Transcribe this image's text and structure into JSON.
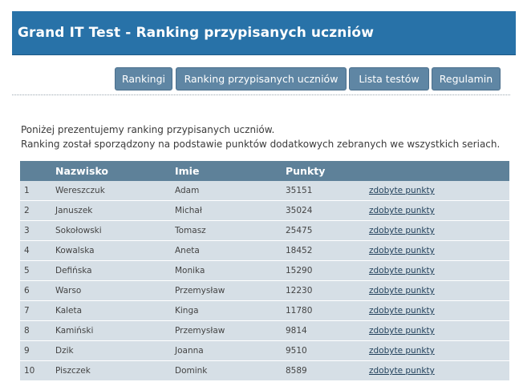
{
  "header": {
    "title": "Grand IT Test - Ranking przypisanych uczniów"
  },
  "nav": {
    "items": [
      {
        "label": "Rankingi"
      },
      {
        "label": "Ranking przypisanych uczniów"
      },
      {
        "label": "Lista testów"
      },
      {
        "label": "Regulamin"
      }
    ]
  },
  "intro": {
    "line1": "Poniżej prezentujemy ranking przypisanych uczniów.",
    "line2": "Ranking został sporządzony na podstawie punktów dodatkowych zebranych we wszystkich seriach."
  },
  "table": {
    "headers": {
      "num": "",
      "nazwisko": "Nazwisko",
      "imie": "Imie",
      "punkty": "Punkty",
      "link": ""
    },
    "rows": [
      {
        "num": "1",
        "nazwisko": "Wereszczuk",
        "imie": "Adam",
        "punkty": "35151",
        "link": "zdobyte punkty"
      },
      {
        "num": "2",
        "nazwisko": "Januszek",
        "imie": "Michał",
        "punkty": "35024",
        "link": "zdobyte punkty"
      },
      {
        "num": "3",
        "nazwisko": "Sokołowski",
        "imie": "Tomasz",
        "punkty": "25475",
        "link": "zdobyte punkty"
      },
      {
        "num": "4",
        "nazwisko": "Kowalska",
        "imie": "Aneta",
        "punkty": "18452",
        "link": "zdobyte punkty"
      },
      {
        "num": "5",
        "nazwisko": "Defińska",
        "imie": "Monika",
        "punkty": "15290",
        "link": "zdobyte punkty"
      },
      {
        "num": "6",
        "nazwisko": "Warso",
        "imie": "Przemysław",
        "punkty": "12230",
        "link": "zdobyte punkty"
      },
      {
        "num": "7",
        "nazwisko": "Kaleta",
        "imie": "Kinga",
        "punkty": "11780",
        "link": "zdobyte punkty"
      },
      {
        "num": "8",
        "nazwisko": "Kamiński",
        "imie": "Przemysław",
        "punkty": "9814",
        "link": "zdobyte punkty"
      },
      {
        "num": "9",
        "nazwisko": "Dzik",
        "imie": "Joanna",
        "punkty": "9510",
        "link": "zdobyte punkty"
      },
      {
        "num": "10",
        "nazwisko": "Piszczek",
        "imie": "Domink",
        "punkty": "8589",
        "link": "zdobyte punkty"
      }
    ]
  },
  "colors": {
    "header_bg": "#2872a8",
    "nav_button_bg": "#5f86a4",
    "table_header_bg": "#5e8199",
    "row_bg": "#d6dfe6"
  }
}
